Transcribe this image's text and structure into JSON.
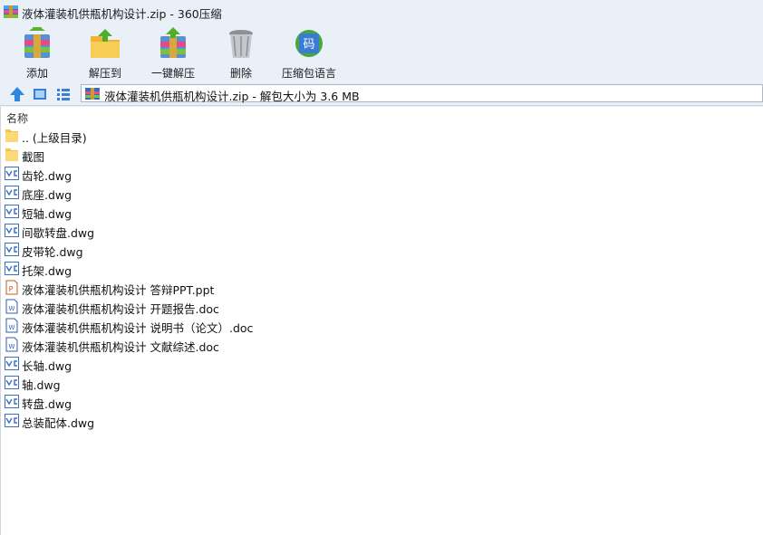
{
  "window": {
    "title": "液体灌装机供瓶机构设计.zip - 360压缩"
  },
  "toolbar": {
    "buttons": [
      {
        "label": "添加",
        "icon": "add-archive-icon"
      },
      {
        "label": "解压到",
        "icon": "extract-to-icon"
      },
      {
        "label": "一键解压",
        "icon": "one-click-extract-icon"
      },
      {
        "label": "删除",
        "icon": "delete-trash-icon"
      },
      {
        "label": "压缩包语言",
        "icon": "archive-language-icon"
      }
    ]
  },
  "address": {
    "path_text": "液体灌装机供瓶机构设计.zip - 解包大小为 3.6 MB"
  },
  "list": {
    "column_name": "名称",
    "files": [
      {
        "name": ".. (上级目录)",
        "type": "folder"
      },
      {
        "name": "截图",
        "type": "folder"
      },
      {
        "name": "齿轮.dwg",
        "type": "dwg"
      },
      {
        "name": "底座.dwg",
        "type": "dwg"
      },
      {
        "name": "短轴.dwg",
        "type": "dwg"
      },
      {
        "name": "间歇转盘.dwg",
        "type": "dwg"
      },
      {
        "name": "皮带轮.dwg",
        "type": "dwg"
      },
      {
        "name": "托架.dwg",
        "type": "dwg"
      },
      {
        "name": "液体灌装机供瓶机构设计 答辩PPT.ppt",
        "type": "ppt"
      },
      {
        "name": "液体灌装机供瓶机构设计 开题报告.doc",
        "type": "doc"
      },
      {
        "name": "液体灌装机供瓶机构设计 说明书（论文）.doc",
        "type": "doc"
      },
      {
        "name": "液体灌装机供瓶机构设计 文献综述.doc",
        "type": "doc"
      },
      {
        "name": "长轴.dwg",
        "type": "dwg"
      },
      {
        "name": "轴.dwg",
        "type": "dwg"
      },
      {
        "name": "转盘.dwg",
        "type": "dwg"
      },
      {
        "name": "总装配体.dwg",
        "type": "dwg"
      }
    ]
  }
}
